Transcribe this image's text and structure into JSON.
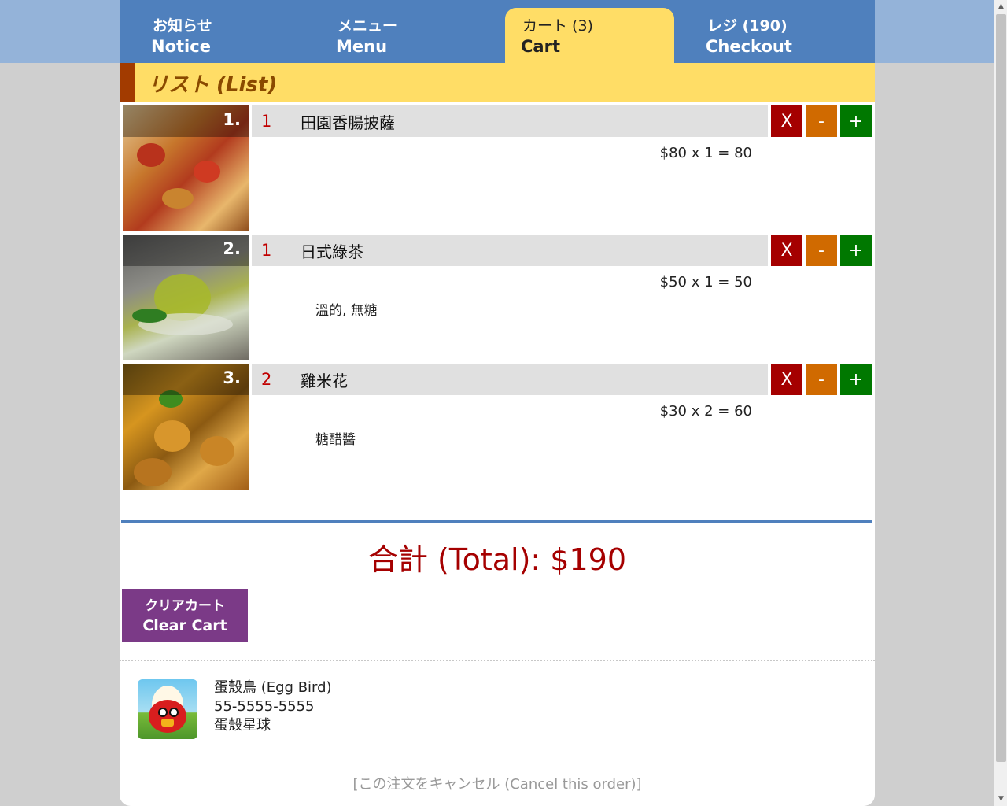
{
  "nav": {
    "tabs": [
      {
        "jp": "お知らせ",
        "en": "Notice"
      },
      {
        "jp": "メニュー",
        "en": "Menu"
      },
      {
        "jp": "カート (3)",
        "en": "Cart"
      },
      {
        "jp": "レジ (190)",
        "en": "Checkout"
      }
    ],
    "active_tab": "Cart"
  },
  "section": {
    "title": "リスト (List)"
  },
  "cart": {
    "items": [
      {
        "index": "1.",
        "qty": "1",
        "name": "田園香腸披薩",
        "price": "$80 x 1 = 80",
        "note": "",
        "photo": "pizza"
      },
      {
        "index": "2.",
        "qty": "1",
        "name": "日式綠茶",
        "price": "$50 x 1 = 50",
        "note": "溫的, 無糖",
        "photo": "green-tea"
      },
      {
        "index": "3.",
        "qty": "2",
        "name": "雞米花",
        "price": "$30 x 2 = 60",
        "note": "糖醋醬",
        "photo": "popcorn-chicken"
      }
    ],
    "buttons": {
      "remove": "X",
      "decrease": "-",
      "increase": "+"
    },
    "total": "合計 (Total): $190",
    "clear_jp": "クリアカート",
    "clear_en": "Clear Cart"
  },
  "shop": {
    "name": "蛋殼鳥 (Egg Bird)",
    "phone": "55-5555-5555",
    "address": "蛋殼星球",
    "avatar_icon": "egg-bird-icon"
  },
  "cancel_link": "[この注文をキャンセル (Cancel this order)]",
  "colors": {
    "nav": "#4f80bd",
    "active_tab": "#ffdd66",
    "remove": "#a50000",
    "decrease": "#d06a00",
    "increase": "#007800",
    "total": "#a50000",
    "clear_button": "#7b3a87"
  }
}
